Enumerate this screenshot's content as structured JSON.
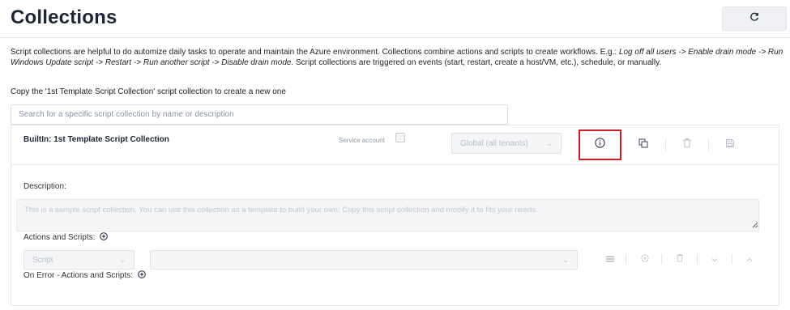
{
  "header": {
    "title": "Collections",
    "refresh_icon": "refresh-icon"
  },
  "intro": {
    "part1": "Script collections are helpful to do automize daily tasks to operate and maintain the Azure environment. Collections combine actions and scripts to create workflows. E.g.: ",
    "example": "Log off all users -> Enable drain mode -> Run Windows Update script -> Restart -> Run another script -> Disable drain mode.",
    "part2": " Script collections are triggered on events (start, restart, create a host/VM, etc.), schedule, or manually."
  },
  "copy_hint": "Copy the '1st Template Script Collection' script collection to create a new one",
  "search": {
    "placeholder": "Search for a specific script collection by name or description",
    "value": ""
  },
  "collection": {
    "name": "BuiltIn: 1st Template Script Collection",
    "service_account_label": "Service account",
    "service_account_checked": false,
    "scope_value": "Global (all tenants)",
    "tools": [
      "info-icon",
      "copy-icon",
      "trash-icon",
      "save-icon"
    ],
    "highlight_color": "#c8202a",
    "description_label": "Description:",
    "description_value": "This is a sample script collection. You can use this collection as a template to build your own: Copy this script collection and modify it to fits your needs.",
    "actions_label": "Actions and Scripts:",
    "action_type": "Script",
    "action_script": "",
    "row_tools": [
      "menu-icon",
      "add-circle-icon",
      "trash-icon",
      "chevron-down-icon",
      "chevron-up-icon"
    ],
    "on_error_label": "On Error - Actions and Scripts:"
  }
}
